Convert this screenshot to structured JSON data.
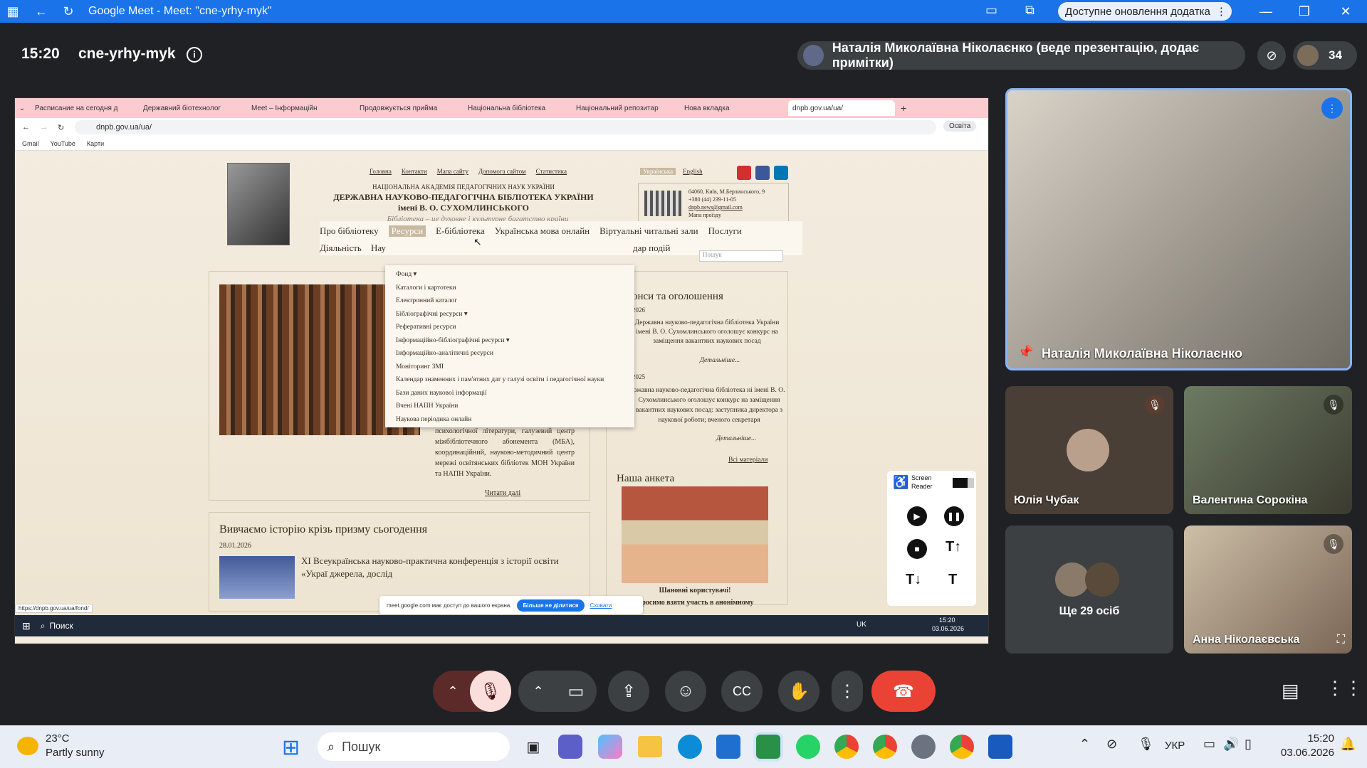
{
  "window": {
    "title": "Google Meet - Meet: \"cne-yrhy-myk\"",
    "update_label": "Доступне оновлення додатка"
  },
  "meet": {
    "time": "15:20",
    "code": "cne-yrhy-myk",
    "presenter_label": "Наталія Миколаївна Ніколаєнко (веде презентацію, додає примітки)",
    "participant_count": "34"
  },
  "browser": {
    "tabs": [
      "Расписание на сегодня д",
      "Державний біотехнолог",
      "Meet – Інформаційн",
      "Продовжується прийма",
      "Національна бібліотека",
      "Національний репозитар",
      "Нова вкладка",
      "dnpb.gov.ua/ua/"
    ],
    "url": "dnpb.gov.ua/ua/",
    "profile": "Освіта",
    "bookmarks": [
      "Gmail",
      "YouTube",
      "Карти"
    ],
    "status_url": "https://dnpb.gov.ua/ua/fond/",
    "share_notice": "meet.google.com має доступ до вашого екрана.",
    "stop_share": "Більше не ділитися",
    "hide": "Сховати"
  },
  "site": {
    "top_links": [
      "Головна",
      "Контакти",
      "Мапа сайту",
      "Допомога сайтом",
      "Статистика"
    ],
    "lang": [
      "Українська",
      "English"
    ],
    "academy": "НАЦІОНАЛЬНА АКАДЕМІЯ ПЕДАГОГІЧНИХ НАУК УКРАЇНИ",
    "library_name": "ДЕРЖАВНА НАУКОВО-ПЕДАГОГІЧНА БІБЛІОТЕКА УКРАЇНИ",
    "library_name2": "імені В. О. СУХОМЛИНСЬКОГО",
    "motto": "Бібліотека – це духовне і культурне багатство країни",
    "address": [
      "04060, Київ, М.Берлинського, 9",
      "+380 (44) 239-11-05",
      "dnpb.news@gmail.com",
      "Мапа проїзду"
    ],
    "menu": [
      "Про бібліотеку",
      "Ресурси",
      "Е-бібліотека",
      "Українська мова онлайн",
      "Віртуальні читальні зали",
      "Послуги"
    ],
    "menu2": [
      "Діяльність",
      "Нау",
      "дар подій"
    ],
    "search_placeholder": "Пошук",
    "dropdown_title": "Фонд ▾",
    "dropdown": [
      "Каталоги і картотеки",
      "Електронний каталог",
      "Бібліографічні ресурси ▾",
      "Реферативні ресурси",
      "Інформаційно-бібліографічні ресурси ▾",
      "Інформаційно-аналітичні ресурси",
      "Моніторинг ЗМІ",
      "Календар знаменних і пам'ятних дат у галузі освіти і педагогічної науки",
      "Бази даних наукової інформації",
      "Вчені НАПН України",
      "Наукова періодика онлайн"
    ],
    "about_text": "психології; депозитарій педагогічної та психологічної літератури, галузевий центр міжбібліотечного абонемента (МБА), координаційний, науково-методичний центр мережі освітянських бібліотек МОН України та НАПН України.",
    "read_more": "Читати далі",
    "history_title": "Вивчаємо історію крізь призму сьогодення",
    "history_date": "28.01.2026",
    "history_text": "XI Всеукраїнська науково-практична конференція з історії освіти «Украї джерела, дослід",
    "news_title": "онси та оголошення",
    "news1_date": "2026",
    "news1_text": "Державна науково-педагогічна бібліотека України імені В. О. Сухомлинського оголошує конкурс на заміщення вакантних наукових посад",
    "news1_more": "Детальніше...",
    "news2_date": "2025",
    "news2_text": "ржавна науково-педагогічна бібліотека ні імені В. О. Сухомлинського оголошує конкурс на заміщення вакантних наукових посад: заступника директора з наукової роботи; вченого секретаря",
    "news2_more": "Детальніше...",
    "all_materials": "Всі матеріали",
    "survey_title": "Наша анкета",
    "survey_text1": "Шановні користувачі!",
    "survey_text2": "Просимо взяти участь в анонімному",
    "screen_reader": "Screen Reader"
  },
  "win_inner": {
    "search": "Поиск",
    "lang": "UK",
    "time": "15:20",
    "date": "03.06.2026"
  },
  "tiles": {
    "main": "Наталія Миколаївна Ніколаєнко",
    "t1": "Юлія Чубак",
    "t2": "Валентина Сорокіна",
    "t3": "Ще 29 осіб",
    "t4": "Анна Ніколаєвська"
  },
  "taskbar": {
    "temp": "23°C",
    "weather": "Partly sunny",
    "search": "Пошук",
    "lang": "УКР",
    "time": "15:20",
    "date": "03.06.2026"
  }
}
